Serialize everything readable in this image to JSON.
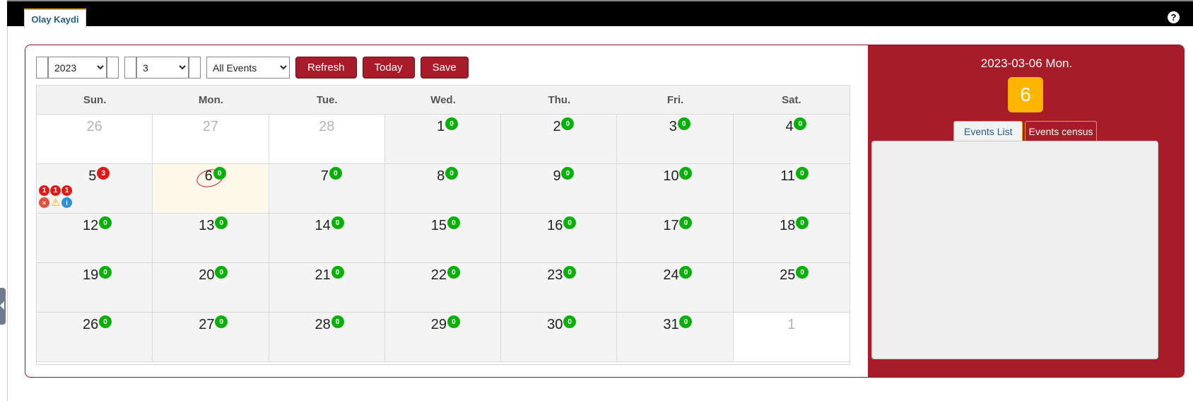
{
  "tab": {
    "label": "Olay Kaydi"
  },
  "help": {
    "glyph": "?"
  },
  "toolbar": {
    "year_value": "2023",
    "month_value": "3",
    "events_filter": "All Events",
    "refresh_label": "Refresh",
    "today_label": "Today",
    "save_label": "Save"
  },
  "calendar": {
    "weekdays": [
      "Sun.",
      "Mon.",
      "Tue.",
      "Wed.",
      "Thu.",
      "Fri.",
      "Sat."
    ],
    "weeks": [
      [
        {
          "day": "26",
          "out": true
        },
        {
          "day": "27",
          "out": true
        },
        {
          "day": "28",
          "out": true
        },
        {
          "day": "1",
          "count": "0"
        },
        {
          "day": "2",
          "count": "0"
        },
        {
          "day": "3",
          "count": "0"
        },
        {
          "day": "4",
          "count": "0"
        }
      ],
      [
        {
          "day": "5",
          "count": "3",
          "count_color": "red",
          "mini_counts": [
            "1",
            "1",
            "1"
          ],
          "mini_icons": [
            "×",
            "⚠",
            "i"
          ]
        },
        {
          "day": "6",
          "count": "0",
          "today": true
        },
        {
          "day": "7",
          "count": "0"
        },
        {
          "day": "8",
          "count": "0"
        },
        {
          "day": "9",
          "count": "0"
        },
        {
          "day": "10",
          "count": "0"
        },
        {
          "day": "11",
          "count": "0"
        }
      ],
      [
        {
          "day": "12",
          "count": "0"
        },
        {
          "day": "13",
          "count": "0"
        },
        {
          "day": "14",
          "count": "0"
        },
        {
          "day": "15",
          "count": "0"
        },
        {
          "day": "16",
          "count": "0"
        },
        {
          "day": "17",
          "count": "0"
        },
        {
          "day": "18",
          "count": "0"
        }
      ],
      [
        {
          "day": "19",
          "count": "0"
        },
        {
          "day": "20",
          "count": "0"
        },
        {
          "day": "21",
          "count": "0"
        },
        {
          "day": "22",
          "count": "0"
        },
        {
          "day": "23",
          "count": "0"
        },
        {
          "day": "24",
          "count": "0"
        },
        {
          "day": "25",
          "count": "0"
        }
      ],
      [
        {
          "day": "26",
          "count": "0"
        },
        {
          "day": "27",
          "count": "0"
        },
        {
          "day": "28",
          "count": "0"
        },
        {
          "day": "29",
          "count": "0"
        },
        {
          "day": "30",
          "count": "0"
        },
        {
          "day": "31",
          "count": "0"
        },
        {
          "day": "1",
          "out": true
        }
      ]
    ]
  },
  "side_panel": {
    "date_label": "2023-03-06 Mon.",
    "day_number": "6",
    "tabs": [
      "Events List",
      "Events census"
    ]
  },
  "colors": {
    "accent": "#a81c29",
    "today_badge": "#ffb400",
    "count_ok": "#0ab00a",
    "count_alert": "#e01919"
  }
}
